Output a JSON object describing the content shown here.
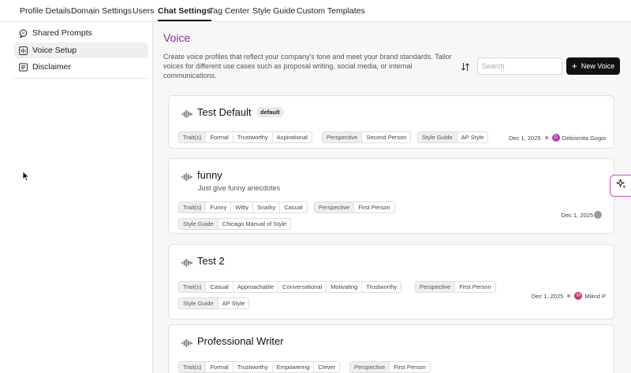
{
  "tabs": [
    {
      "label": "Profile Details"
    },
    {
      "label": "Domain Settings"
    },
    {
      "label": "Users"
    },
    {
      "label": "Chat Settings"
    },
    {
      "label": "Tag Center"
    },
    {
      "label": "Style Guide"
    },
    {
      "label": "Custom Templates"
    }
  ],
  "sidebar": {
    "items": [
      {
        "label": "Shared Prompts",
        "icon": "chat-bubble-icon"
      },
      {
        "label": "Voice Setup",
        "icon": "waveform-icon"
      },
      {
        "label": "Disclaimer",
        "icon": "document-lines-icon"
      }
    ]
  },
  "main": {
    "title": "Voice",
    "description": "Create voice profiles that reflect your company's tone and meet your brand standards. Tailor voices for different use cases such as proposal writing, social media, or internal communications.",
    "search_placeholder": "Search",
    "new_button": "New Voice",
    "accent_color": "#8e2c8e"
  },
  "cards": [
    {
      "title": "Test Default",
      "badge": "default",
      "traits_label": "Trait(s)",
      "traits": [
        "Formal",
        "Trustworthy",
        "Aspirational"
      ],
      "perspective_label": "Perspective",
      "perspective": "Second Person",
      "style_label": "Style Guide",
      "style": "AP Style",
      "date": "Dec 1, 2025",
      "author": "Debismita Gogoi",
      "avatar_letter": "D",
      "avatar_color": "#b03ab0"
    },
    {
      "title": "funny",
      "subtitle": "Just give funny anecdotes",
      "traits_label": "Trait(s)",
      "traits": [
        "Funny",
        "Witty",
        "Snarky",
        "Casual"
      ],
      "perspective_label": "Perspective",
      "perspective": "First Person",
      "style_label": "Style Guide",
      "style": "Chicago Manual of Style",
      "date": "Dec 1, 2025",
      "avatar_color": "#9a9a9a"
    },
    {
      "title": "Test 2",
      "traits_label": "Trait(s)",
      "traits": [
        "Casual",
        "Approachable",
        "Conversational",
        "Motivating",
        "Trustworthy"
      ],
      "perspective_label": "Perspective",
      "perspective": "First Person",
      "style_label": "Style Guide",
      "style": "AP Style",
      "date": "Dec 1, 2025",
      "author": "Milind P",
      "avatar_letter": "M",
      "avatar_color": "#c8356b"
    },
    {
      "title": "Professional Writer",
      "traits_label": "Trait(s)",
      "traits": [
        "Formal",
        "Trustworthy",
        "Empowering",
        "Clever"
      ],
      "perspective_label": "Perspective",
      "perspective": "First Person"
    }
  ]
}
